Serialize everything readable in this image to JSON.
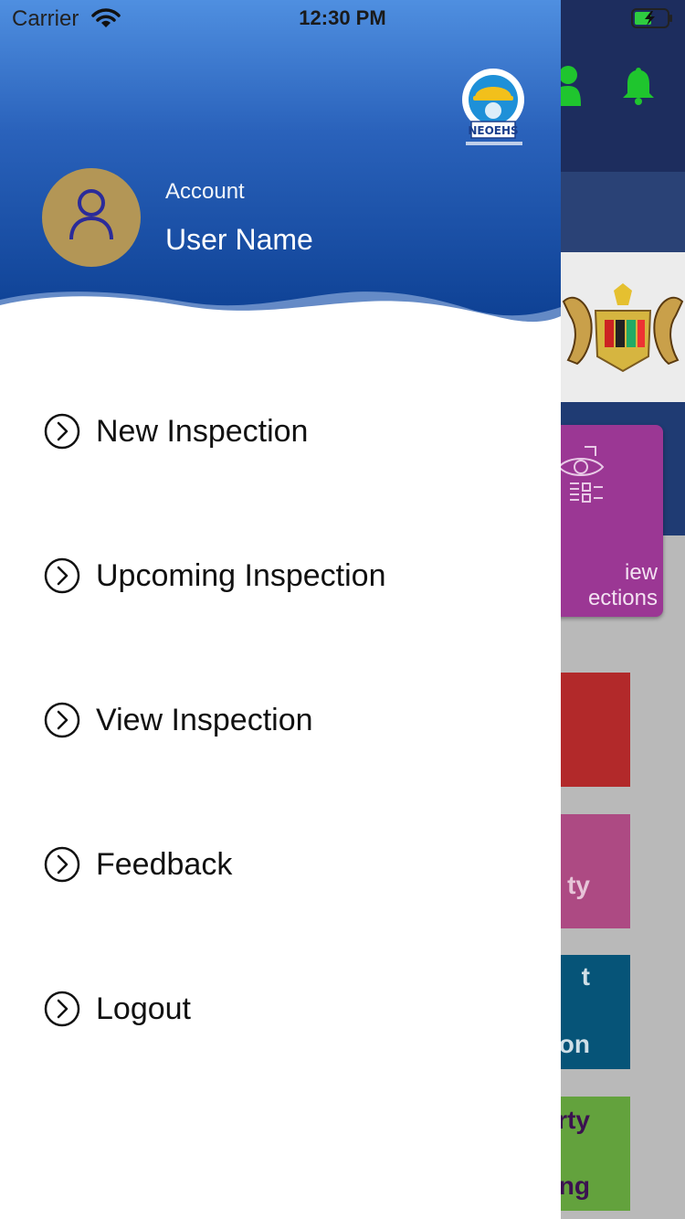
{
  "status_bar": {
    "carrier": "Carrier",
    "time": "12:30 PM"
  },
  "drawer": {
    "account_label": "Account",
    "user_name": "User Name",
    "logo_text": "NEOEHS",
    "menu": [
      {
        "label": "New Inspection",
        "icon": "chevron-circle-icon"
      },
      {
        "label": "Upcoming Inspection",
        "icon": "chevron-circle-icon"
      },
      {
        "label": "View Inspection",
        "icon": "chevron-circle-icon"
      },
      {
        "label": "Feedback",
        "icon": "chevron-circle-icon"
      },
      {
        "label": "Logout",
        "icon": "chevron-circle-icon"
      }
    ]
  },
  "background": {
    "tiles": [
      {
        "text_line1": "iew",
        "text_line2": "ections",
        "color": "#9b3794"
      },
      {
        "text": "",
        "color": "#b2292a"
      },
      {
        "text": "ty",
        "color": "#ad4a83"
      },
      {
        "text_line1": "t",
        "text_line2": "on",
        "color": "#065478"
      },
      {
        "text_line1": "rty",
        "text_line2": "ng",
        "color": "#63a23d"
      }
    ]
  },
  "colors": {
    "accent_icon": "#1fc52e",
    "header_top": "#4f8fe0",
    "header_bottom": "#0c3f92"
  }
}
